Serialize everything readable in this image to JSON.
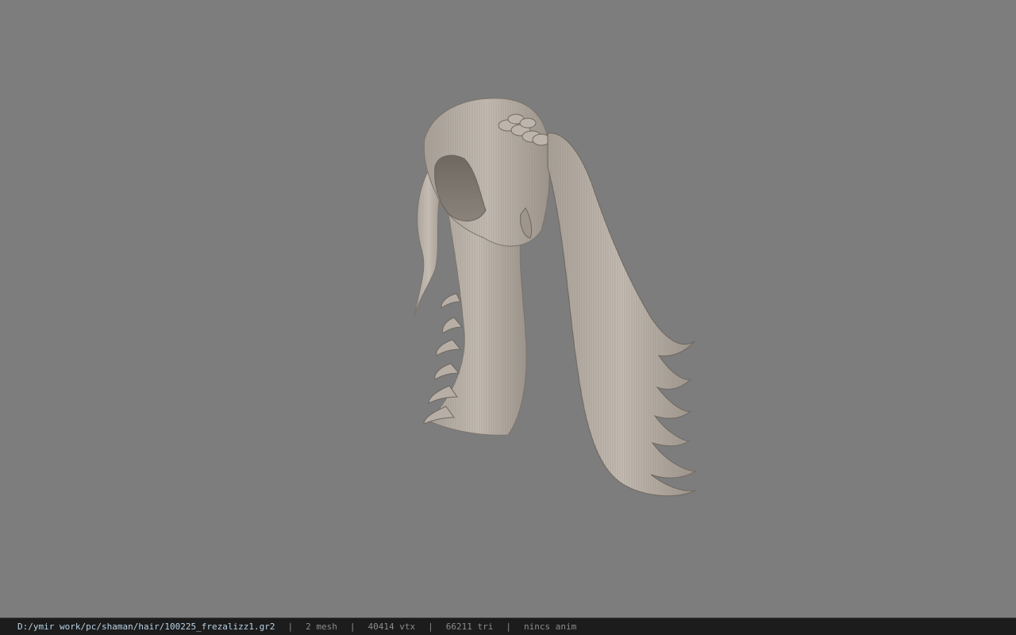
{
  "viewport": {
    "background_color": "#7d7d7d",
    "model_name": "hair-model"
  },
  "statusbar": {
    "file_path": "D:/ymir work/pc/shaman/hair/100225_frezalizz1.gr2",
    "separator": "|",
    "mesh_count": "2 mesh",
    "vertex_count": "40414 vtx",
    "triangle_count": "66211 tri",
    "anim_status": "nincs anim"
  }
}
